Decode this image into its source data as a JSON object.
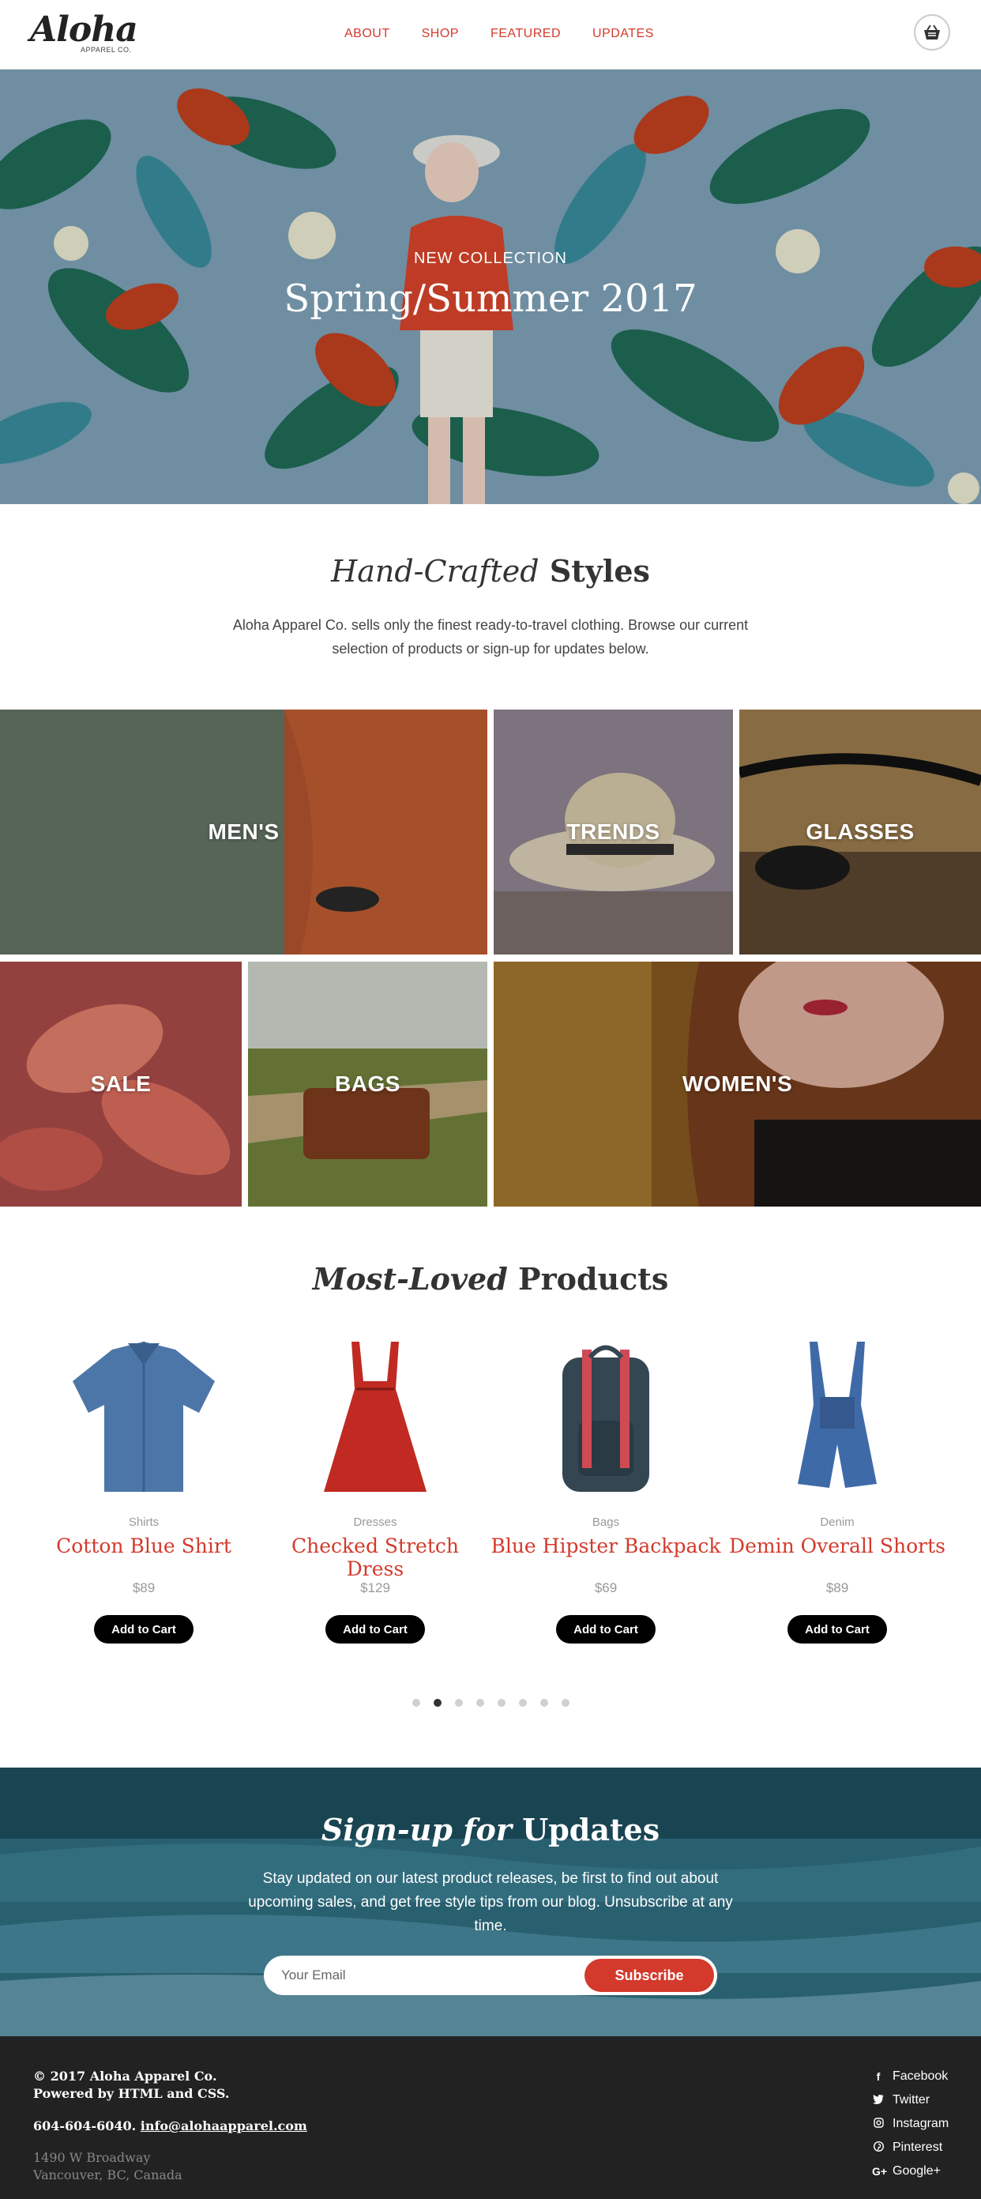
{
  "brand": {
    "name": "Aloha",
    "sub": "APPAREL CO."
  },
  "nav": [
    "ABOUT",
    "SHOP",
    "FEATURED",
    "UPDATES"
  ],
  "hero": {
    "eyebrow": "NEW COLLECTION",
    "title": "Spring/Summer 2017"
  },
  "intro": {
    "title_italic": "Hand-Crafted",
    "title_bold": "Styles",
    "text": "Aloha Apparel Co. sells only the finest ready-to-travel clothing. Browse our current selection of products or sign-up for updates below."
  },
  "categories": [
    "MEN'S",
    "TRENDS",
    "GLASSES",
    "SALE",
    "BAGS",
    "WOMEN'S"
  ],
  "products_section": {
    "title_italic": "Most-Loved",
    "title_bold": "Products"
  },
  "products": [
    {
      "category": "Shirts",
      "name": "Cotton Blue Shirt",
      "price": "$89",
      "button": "Add to Cart"
    },
    {
      "category": "Dresses",
      "name": "Checked Stretch Dress",
      "price": "$129",
      "button": "Add to Cart"
    },
    {
      "category": "Bags",
      "name": "Blue Hipster Backpack",
      "price": "$69",
      "button": "Add to Cart"
    },
    {
      "category": "Denim",
      "name": "Demin Overall Shorts",
      "price": "$89",
      "button": "Add to Cart"
    }
  ],
  "carousel": {
    "total": 8,
    "active": 2
  },
  "signup": {
    "title_italic": "Sign-up for",
    "title_bold": "Updates",
    "text": "Stay updated on our latest product releases, be first to find out about upcoming sales, and get free style tips from our blog. Unsubscribe at any time.",
    "placeholder": "Your Email",
    "button": "Subscribe"
  },
  "footer": {
    "copyright": "© 2017 Aloha Apparel Co.",
    "powered": "Powered by HTML and CSS.",
    "phone": "604-604-6040.",
    "email": "info@alohaapparel.com",
    "address_line1": "1490 W Broadway",
    "address_line2": "Vancouver, BC, Canada",
    "social": [
      {
        "icon": "facebook-icon",
        "label": "Facebook"
      },
      {
        "icon": "twitter-icon",
        "label": "Twitter"
      },
      {
        "icon": "instagram-icon",
        "label": "Instagram"
      },
      {
        "icon": "pinterest-icon",
        "label": "Pinterest"
      },
      {
        "icon": "google-plus-icon",
        "label": "Google+"
      }
    ]
  },
  "colors": {
    "accent": "#d33a2c",
    "footer_bg": "#222222",
    "hero_bg": "#7fa2b9"
  }
}
